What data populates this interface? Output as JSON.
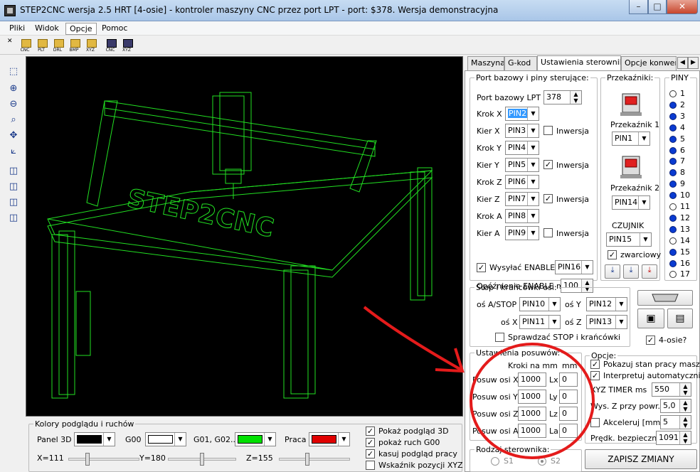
{
  "window": {
    "title": "STEP2CNC wersja 2.5 HRT [4-osie] - kontroler maszyny CNC przez port LPT - port: $378. Wersja demonstracyjna",
    "minimize": "–",
    "maximize": "□",
    "close": "✕"
  },
  "menu": [
    "Pliki",
    "Widok",
    "Opcje",
    "Pomoc"
  ],
  "toolbar": {
    "close": "✕",
    "buttons": [
      "CNC",
      "PLT",
      "DRL",
      "BMP",
      "XYZ",
      "CNC",
      "XYZ"
    ]
  },
  "left_tools": [
    "⬚",
    "⊕",
    "⊖",
    "⌕",
    "✥",
    "⟀",
    "◫",
    "◫",
    "◫",
    "◫"
  ],
  "viewport": {
    "logo_text": "STEP2CNC"
  },
  "colors_panel": {
    "legend": "Kolory podglądu i ruchów",
    "panel3d_label": "Panel 3D",
    "panel3d_color": "#000000",
    "g00_label": "G00",
    "g00_color": "#ffffff",
    "g01_label": "G01, G02...",
    "g01_color": "#00e000",
    "praca_label": "Praca",
    "praca_color": "#e00000",
    "checkboxes": [
      {
        "label": "Pokaż podgląd 3D",
        "checked": true
      },
      {
        "label": "pokaż ruch G00",
        "checked": true
      },
      {
        "label": "kasuj podgląd pracy",
        "checked": true
      },
      {
        "label": "Wskaźnik pozycji XYZ",
        "checked": false
      }
    ],
    "sliders": {
      "x_label": "X=111",
      "x_level": 0.27,
      "y_label": "Y=180",
      "y_level": 0.5,
      "z_label": "Z=155",
      "z_level": 0.4
    }
  },
  "tabs": [
    "Maszyna",
    "G-kod",
    "Ustawienia sterownika",
    "Opcje konwersji"
  ],
  "tab_arrows": [
    "◀",
    "▶"
  ],
  "port_group": {
    "legend": "Port bazowy i piny sterujące:",
    "port_label": "Port bazowy LPT $",
    "port_value": "378",
    "rows": [
      {
        "label": "Krok X",
        "pin": "PIN2",
        "selected": true,
        "inv": null
      },
      {
        "label": "Kier X",
        "pin": "PIN3",
        "inv": false
      },
      {
        "label": "Krok Y",
        "pin": "PIN4",
        "inv": null
      },
      {
        "label": "Kier Y",
        "pin": "PIN5",
        "inv": true
      },
      {
        "label": "Krok Z",
        "pin": "PIN6",
        "inv": null
      },
      {
        "label": "Kier Z",
        "pin": "PIN7",
        "inv": true
      },
      {
        "label": "Krok A",
        "pin": "PIN8",
        "inv": null
      },
      {
        "label": "Kier A",
        "pin": "PIN9",
        "inv": false
      }
    ],
    "inv_label": "Inwersja",
    "enable_label": "Wysyłać ENABLE",
    "enable_pin": "PIN16",
    "delay_label": "Opóźnienie ENABLE ms",
    "delay_value": "100"
  },
  "relay_group": {
    "legend": "Przekaźniki:",
    "relay1_label": "Przekaźnik 1",
    "relay1_pin": "PIN1",
    "relay2_label": "Przekaźnik 2",
    "relay2_pin": "PIN14",
    "sensor_label": "CZUJNIK",
    "sensor_pin": "PIN15",
    "shorted_label": "zwarciowy"
  },
  "pins_group": {
    "legend": "PINY",
    "pins": [
      {
        "n": "1",
        "on": false
      },
      {
        "n": "2",
        "on": true
      },
      {
        "n": "3",
        "on": true
      },
      {
        "n": "4",
        "on": true
      },
      {
        "n": "5",
        "on": true
      },
      {
        "n": "6",
        "on": true
      },
      {
        "n": "7",
        "on": true
      },
      {
        "n": "8",
        "on": true
      },
      {
        "n": "9",
        "on": true
      },
      {
        "n": "10",
        "on": true
      },
      {
        "n": "11",
        "on": false
      },
      {
        "n": "12",
        "on": true
      },
      {
        "n": "13",
        "on": true
      },
      {
        "n": "14",
        "on": false
      },
      {
        "n": "15",
        "on": true
      },
      {
        "n": "16",
        "on": true
      },
      {
        "n": "17",
        "on": false
      }
    ]
  },
  "stop_group": {
    "legend": "Stop i krańcówki osi:",
    "a_label": "oś A/STOP",
    "a_pin": "PIN10",
    "y_label": "oś Y",
    "y_pin": "PIN12",
    "x_label": "oś X",
    "x_pin": "PIN11",
    "z_label": "oś Z",
    "z_pin": "PIN13",
    "check_label": "Sprawdzać STOP i krańcówki"
  },
  "four_axes_label": "4-osie?",
  "feed_group": {
    "legend": "Ustawienia posuwów:",
    "header_steps": "Kroki na mm",
    "header_mm": "mm",
    "rows": [
      {
        "label": "Posuw osi X",
        "steps": "1000",
        "l": "Lx",
        "lv": "0"
      },
      {
        "label": "Posuw osi Y",
        "steps": "1000",
        "l": "Ly",
        "lv": "0"
      },
      {
        "label": "Posuw osi Z",
        "steps": "1000",
        "l": "Lz",
        "lv": "0"
      },
      {
        "label": "Posuw osi A",
        "steps": "1000",
        "l": "La",
        "lv": "0"
      }
    ]
  },
  "options_group": {
    "legend": "Opcje:",
    "show_state": "Pokazuj stan pracy masz.",
    "interpret": "Interpretuj automatycznie",
    "timer_label": "XYZ TIMER ms",
    "timer_value": "550",
    "z_label": "Wys. Z przy powr.",
    "z_value": "5,0",
    "accel_label": "Akceleruj [mm]",
    "accel_value": "5",
    "safe_label": "Prędk. bezpieczna",
    "safe_value": "1091"
  },
  "driver_group": {
    "legend": "Rodzaj sterownika:",
    "s1": "S1",
    "s2": "S2"
  },
  "save_button": "ZAPISZ ZMIANY"
}
